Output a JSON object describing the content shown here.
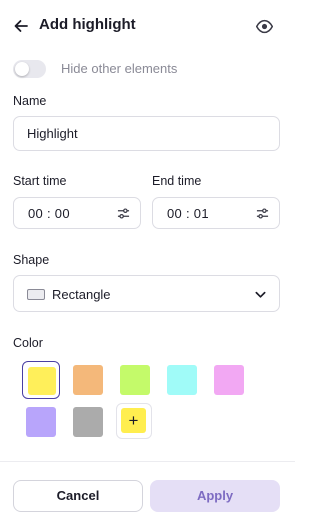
{
  "header": {
    "title": "Add highlight",
    "back_icon": "arrow-left-icon",
    "visibility_icon": "eye-icon"
  },
  "toggle": {
    "label": "Hide other elements",
    "checked": false
  },
  "name": {
    "label": "Name",
    "value": "Highlight"
  },
  "start_time": {
    "label": "Start time",
    "value": "00 : 00"
  },
  "end_time": {
    "label": "End time",
    "value": "00 : 01"
  },
  "shape": {
    "label": "Shape",
    "value": "Rectangle"
  },
  "color": {
    "label": "Color",
    "selected": "#ffef5a",
    "swatches": [
      "#ffef5a",
      "#f4b87a",
      "#c4fa6a",
      "#a0fbf8",
      "#f2a8f3",
      "#b8a5fb",
      "#ababab"
    ],
    "add_label": "+",
    "add_swatch_color": "#ffee4f"
  },
  "actions": {
    "cancel_label": "Cancel",
    "apply_label": "Apply",
    "apply_color": "#e5dff6"
  }
}
